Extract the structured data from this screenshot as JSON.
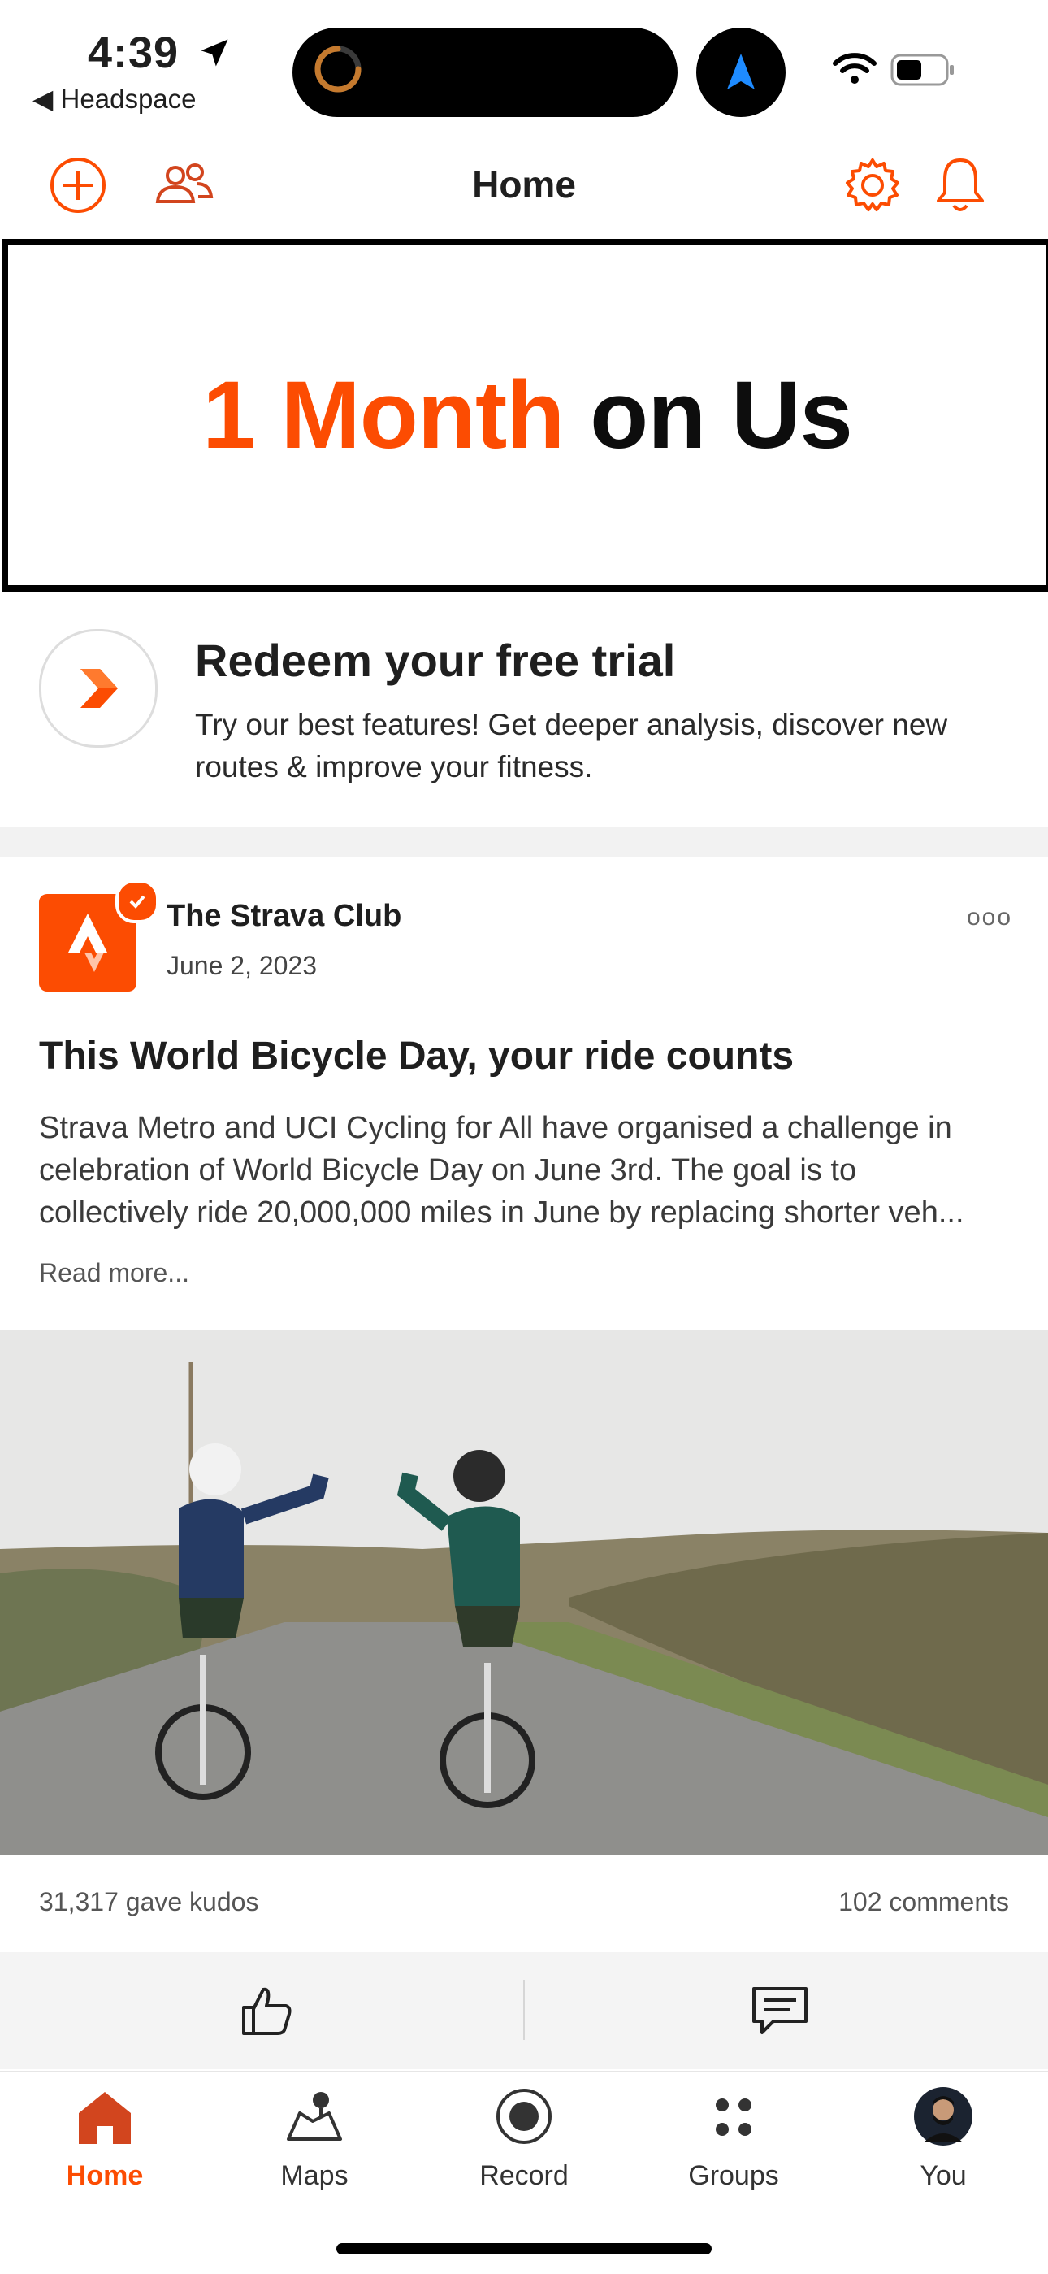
{
  "status_bar": {
    "time": "4:39",
    "back_app": "◀ Headspace"
  },
  "header": {
    "title": "Home"
  },
  "promo": {
    "highlight": "1 Month",
    "rest": "on Us"
  },
  "trial": {
    "title": "Redeem your free trial",
    "description": "Try our best features! Get deeper analysis, discover new routes & improve your fitness."
  },
  "post": {
    "author": "The Strava Club",
    "date": "June 2, 2023",
    "more_label": "ooo",
    "title": "This World Bicycle Day, your ride counts",
    "body_lines": [
      "Strava Metro and UCI Cycling for All have organised a challenge in",
      "celebration of World Bicycle Day on June 3rd. The goal is to",
      "collectively ride 20,000,000 miles in June by replacing shorter veh..."
    ],
    "read_more": "Read more...",
    "kudos": "31,317 gave kudos",
    "comments": "102 comments"
  },
  "tabs": [
    {
      "label": "Home",
      "icon": "home-icon",
      "active": true
    },
    {
      "label": "Maps",
      "icon": "map-icon"
    },
    {
      "label": "Record",
      "icon": "record-icon"
    },
    {
      "label": "Groups",
      "icon": "groups-icon"
    },
    {
      "label": "You",
      "icon": "avatar"
    }
  ],
  "colors": {
    "accent": "#fc4c02",
    "text": "#1f1f1f"
  }
}
